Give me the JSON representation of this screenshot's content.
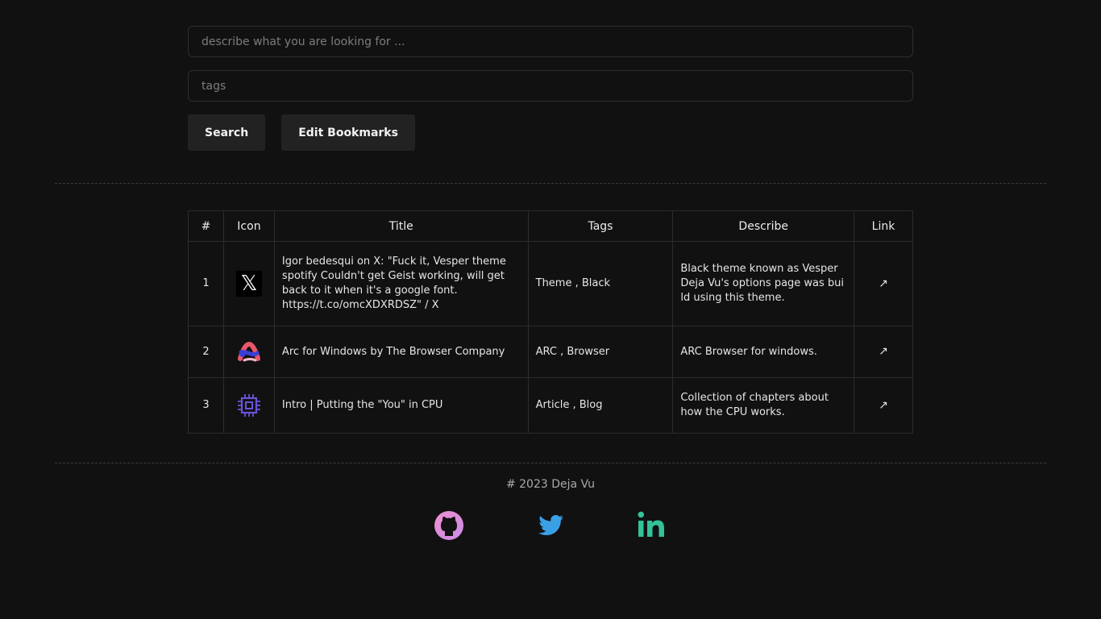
{
  "search": {
    "describe_placeholder": "describe what you are looking for ...",
    "describe_value": "",
    "tags_placeholder": "tags",
    "tags_value": "",
    "search_label": "Search",
    "edit_label": "Edit Bookmarks"
  },
  "table": {
    "headers": [
      "#",
      "Icon",
      "Title",
      "Tags",
      "Describe",
      "Link"
    ],
    "rows": [
      {
        "num": "1",
        "icon": "x-logo-icon",
        "title": "Igor bedesqui on X: \"Fuck it, Vesper theme spotify Couldn't get Geist working, will get back to it when it's a google font. https://t.co/omcXDXRDSZ\" / X",
        "tags": "Theme , Black",
        "describe": "Black theme known as Vesper Deja Vu's options page was build using this theme.",
        "link": "↗"
      },
      {
        "num": "2",
        "icon": "arc-browser-icon",
        "title": "Arc for Windows by The Browser Company",
        "tags": "ARC , Browser",
        "describe": "ARC Browser for windows.",
        "link": "↗"
      },
      {
        "num": "3",
        "icon": "cpu-chip-icon",
        "title": "Intro | Putting the \"You\" in CPU",
        "tags": "Article , Blog",
        "describe": "Collection of chapters about how the CPU works.",
        "link": "↗"
      }
    ]
  },
  "footer": {
    "copyright": "# 2023 Deja Vu",
    "social": [
      "github-icon",
      "twitter-icon",
      "linkedin-icon"
    ]
  },
  "colors": {
    "background": "#111111",
    "button": "#222222",
    "github_pink": "#e58ad8",
    "twitter_blue": "#3aa0e6",
    "linkedin_teal": "#33c29a"
  }
}
